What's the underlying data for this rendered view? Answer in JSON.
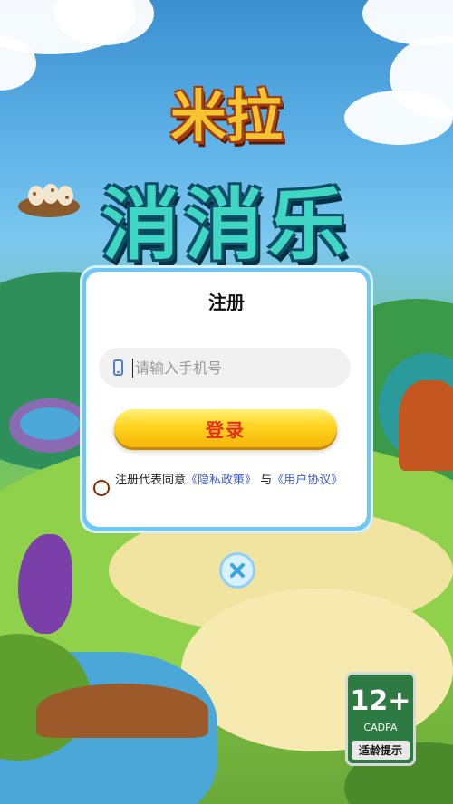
{
  "game": {
    "title_line1": "米拉",
    "title_line2": "消消乐"
  },
  "dialog": {
    "title": "注册",
    "phone_placeholder": "请输入手机号",
    "phone_value": "",
    "login_label": "登录",
    "agree_prefix": "注册代表同意",
    "privacy_link": "《隐私政策》",
    "agree_and": "与",
    "terms_link": "《用户协议》",
    "agree_checked": false
  },
  "icons": {
    "phone": "phone-icon",
    "close": "close-icon"
  },
  "age_rating": {
    "rating": "12+",
    "org": "CADPA",
    "tip": "适龄提示"
  },
  "colors": {
    "dialog_border": "#6fc7f5",
    "login_button": "#ffd31e",
    "login_text": "#e82b1c",
    "link": "#3a58d6",
    "age_badge": "#2e7a43"
  }
}
